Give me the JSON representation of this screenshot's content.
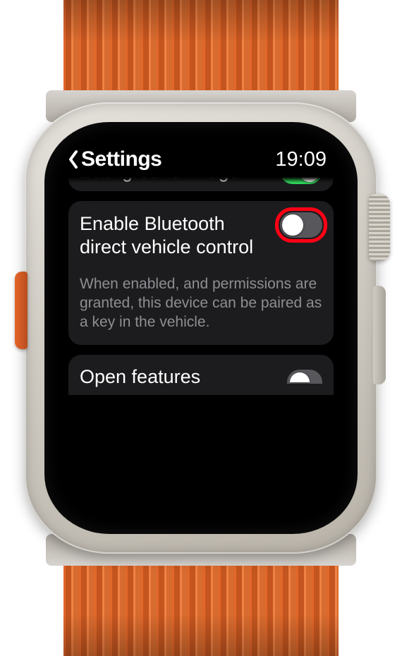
{
  "header": {
    "back_label": "Settings",
    "time": "19:09"
  },
  "rows": {
    "background_image": {
      "label": "Background Image",
      "enabled": true
    },
    "bluetooth": {
      "label": "Enable Bluetooth direct vehicle control",
      "enabled": false,
      "description": "When enabled, and permissions are granted, this device can be paired as a key in the vehicle."
    },
    "open_features": {
      "label": "Open features",
      "enabled": false
    }
  }
}
